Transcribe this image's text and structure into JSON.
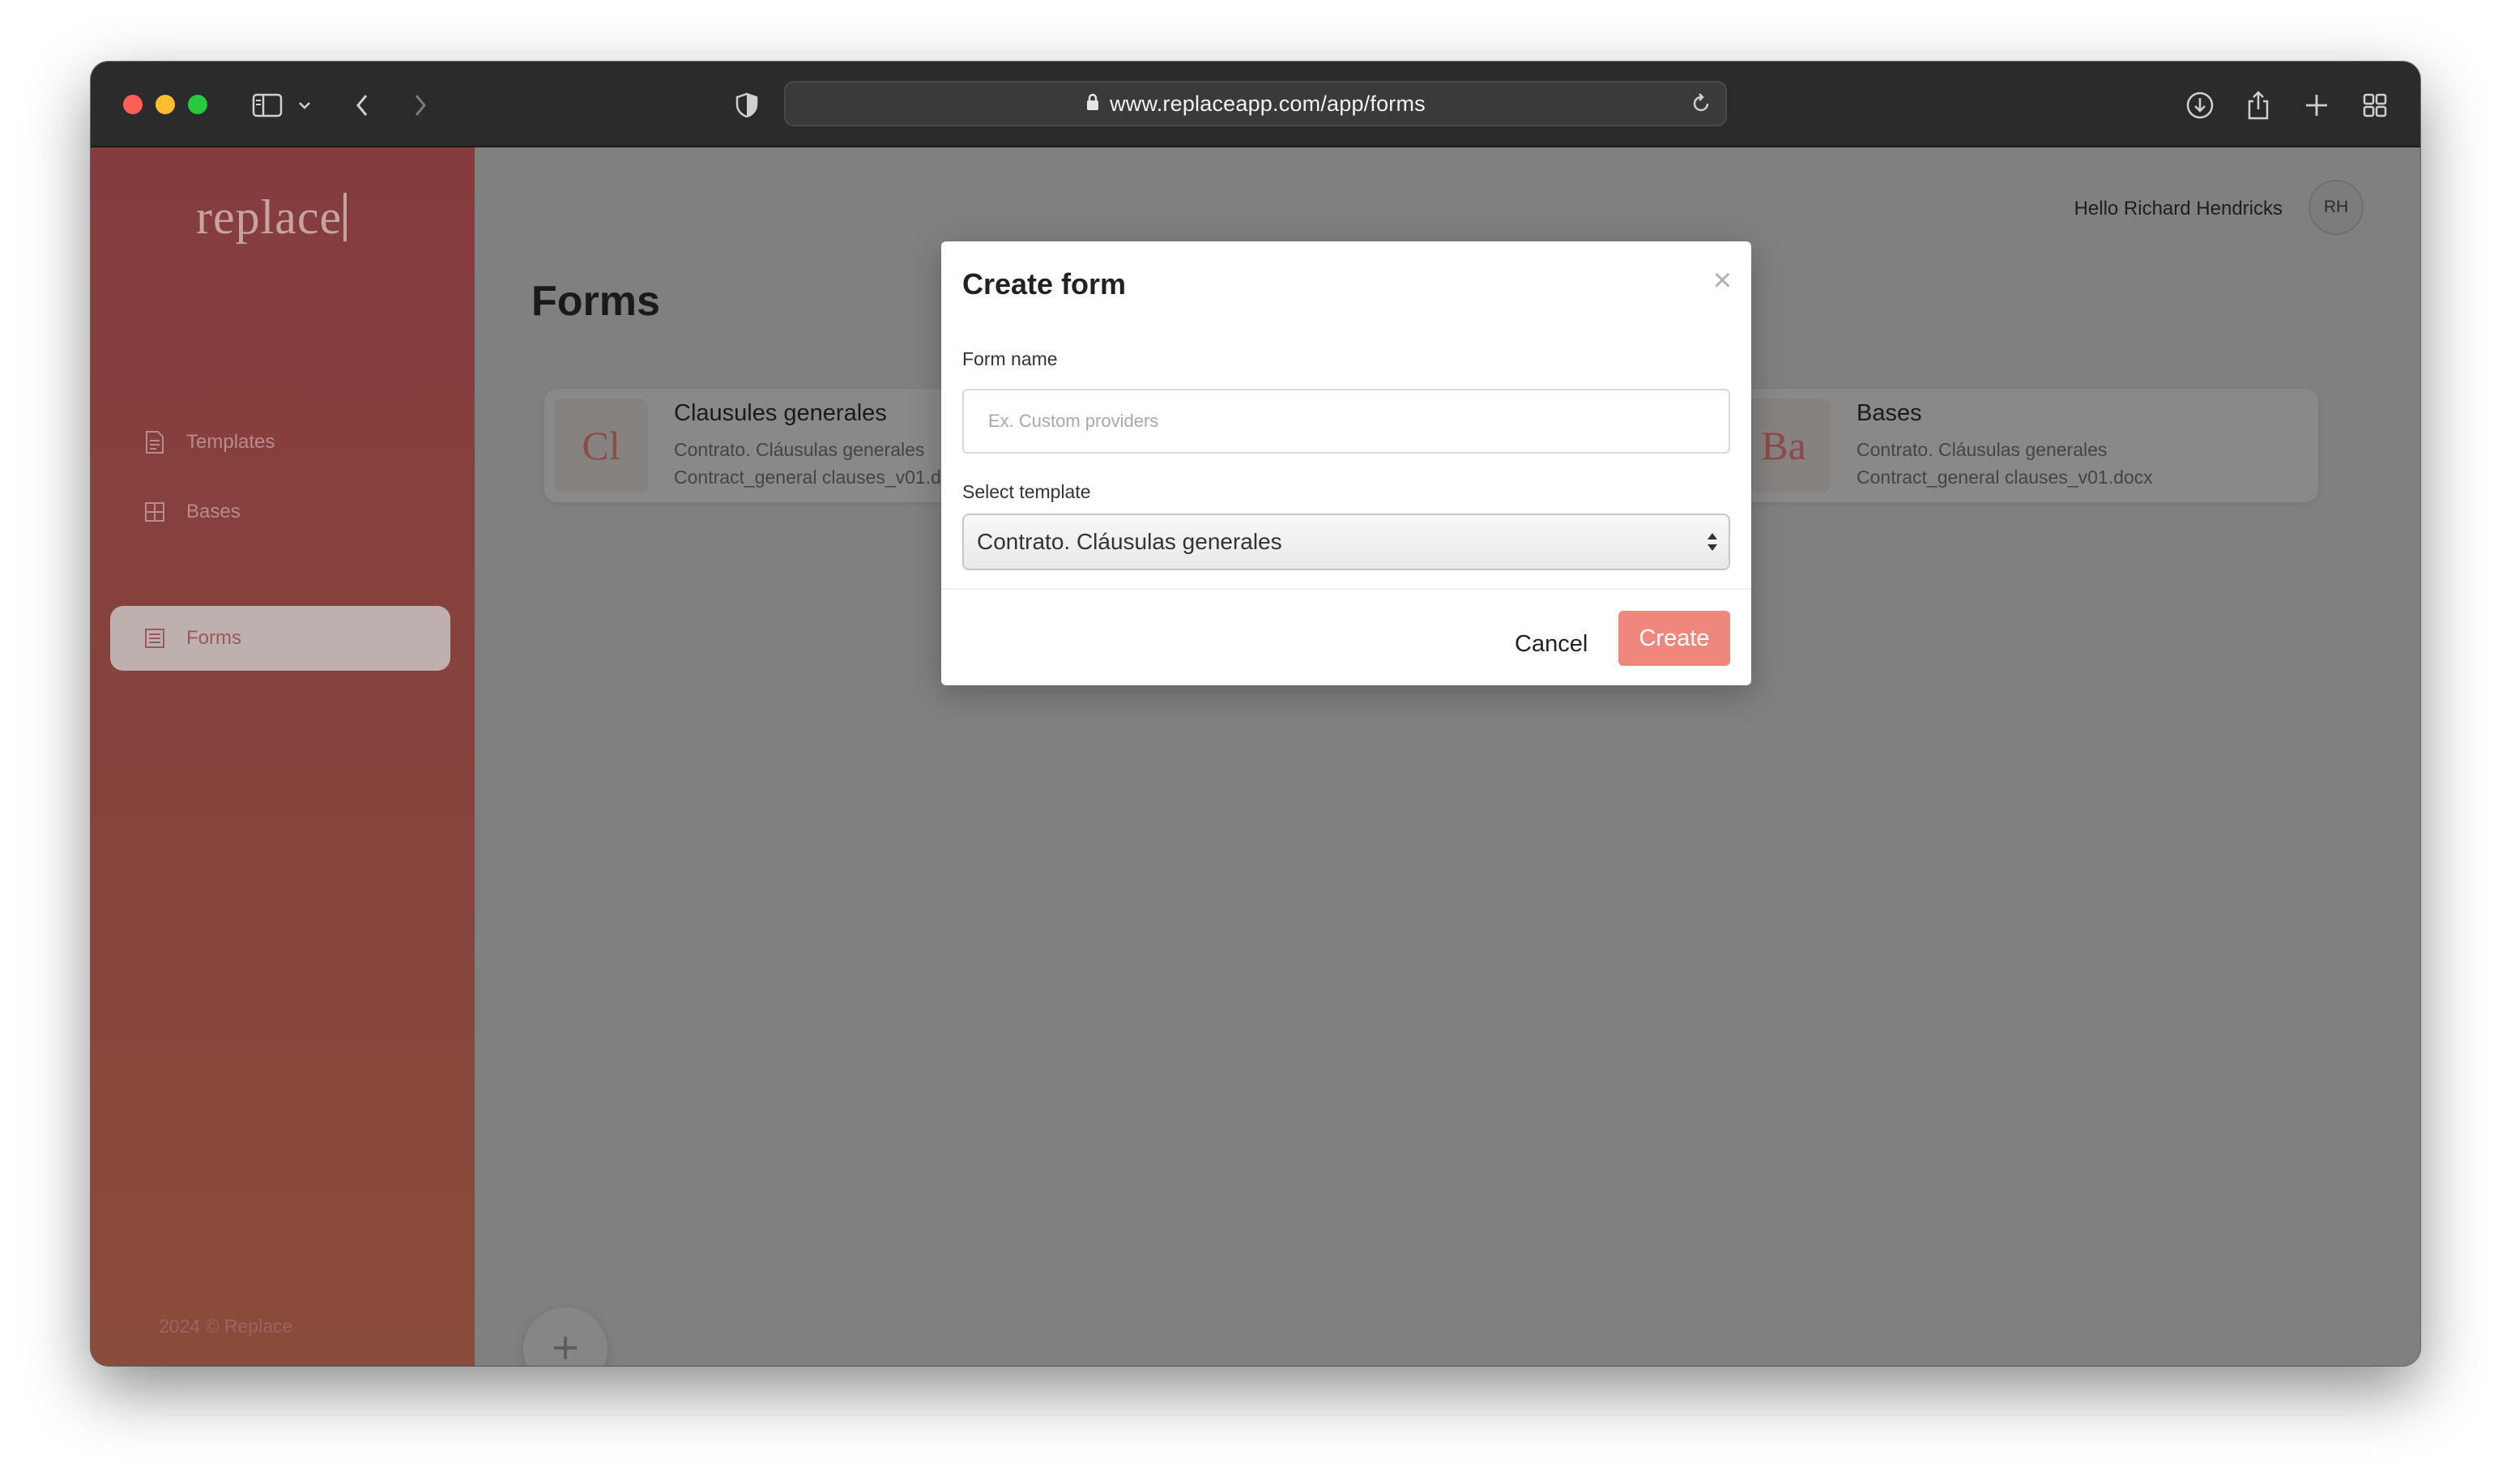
{
  "browser": {
    "url": "www.replaceapp.com/app/forms"
  },
  "sidebar": {
    "logo": "replace",
    "items": [
      {
        "label": "Templates",
        "icon": "document-icon"
      },
      {
        "label": "Bases",
        "icon": "grid-icon"
      },
      {
        "label": "Forms",
        "icon": "form-icon",
        "active": true
      }
    ],
    "footer": "2024 © Replace"
  },
  "header": {
    "greeting": "Hello Richard Hendricks",
    "avatar_initials": "RH"
  },
  "main": {
    "title": "Forms",
    "cards": [
      {
        "thumb": "Cl",
        "title": "Clausules generales",
        "line1": "Contrato. Cláusulas generales",
        "line2": "Contract_general clauses_v01.docx"
      },
      {
        "thumb": "Ba",
        "title": "Bases",
        "line1": "Contrato. Cláusulas generales",
        "line2": "Contract_general clauses_v01.docx"
      }
    ]
  },
  "modal": {
    "title": "Create form",
    "close": "×",
    "form_name_label": "Form name",
    "form_name_placeholder": "Ex. Custom providers",
    "form_name_value": "",
    "template_label": "Select template",
    "template_selected": "Contrato. Cláusulas generales",
    "cancel_label": "Cancel",
    "create_label": "Create"
  },
  "colors": {
    "accent": "#f0877d",
    "sidebar": "#853c3e"
  }
}
